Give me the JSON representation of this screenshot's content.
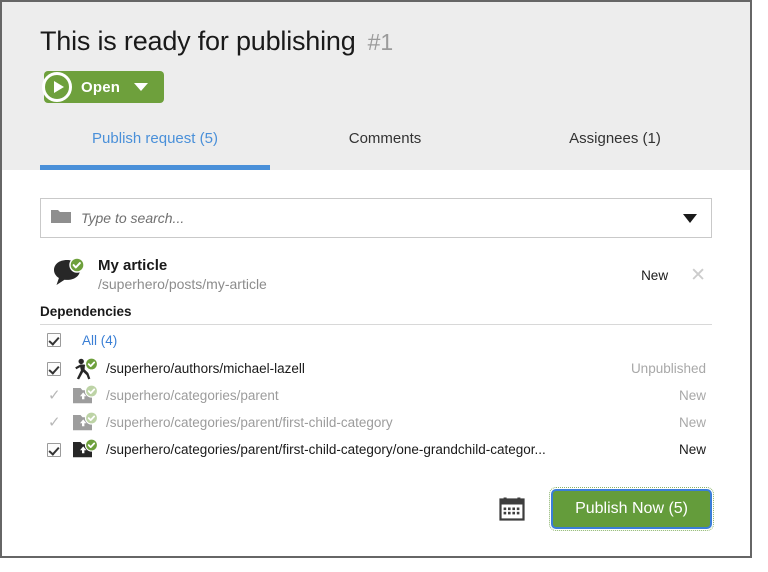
{
  "header": {
    "title": "This is ready for publishing",
    "issue_number": "#1",
    "status_button": {
      "label": "Open",
      "icon": "play-circle-icon",
      "caret": "chevron-down-icon",
      "color": "#6ea03c"
    }
  },
  "tabs": [
    {
      "label": "Publish request (5)",
      "active": true
    },
    {
      "label": "Comments",
      "active": false
    },
    {
      "label": "Assignees (1)",
      "active": false
    }
  ],
  "accent_color": "#4a90d9",
  "search": {
    "placeholder": "Type to search...",
    "value": "",
    "icon": "folder-icon",
    "dropdown_icon": "chevron-down-icon"
  },
  "item": {
    "icon": "comment-bubble-published-icon",
    "title": "My article",
    "path": "/superhero/posts/my-article",
    "state": "New",
    "close_icon": "close-icon"
  },
  "dependencies": {
    "heading": "Dependencies",
    "all_label": "All (4)",
    "all_checked": true,
    "rows": [
      {
        "icon": "author-published-icon",
        "label": "/superhero/authors/michael-lazell",
        "state": "Unpublished",
        "checked": true,
        "enabled": true
      },
      {
        "icon": "category-folder-published-icon",
        "label": "/superhero/categories/parent",
        "state": "New",
        "checked": true,
        "enabled": false
      },
      {
        "icon": "category-folder-published-icon",
        "label": "/superhero/categories/parent/first-child-category",
        "state": "New",
        "checked": true,
        "enabled": false
      },
      {
        "icon": "category-folder-published-icon",
        "label": "/superhero/categories/parent/first-child-category/one-grandchild-categor...",
        "state": "New",
        "checked": true,
        "enabled": true
      }
    ]
  },
  "footer": {
    "calendar_icon": "calendar-icon",
    "publish_label": "Publish Now (5)",
    "publish_color": "#649c3b",
    "focus_ring_color": "#3b7dd8"
  }
}
